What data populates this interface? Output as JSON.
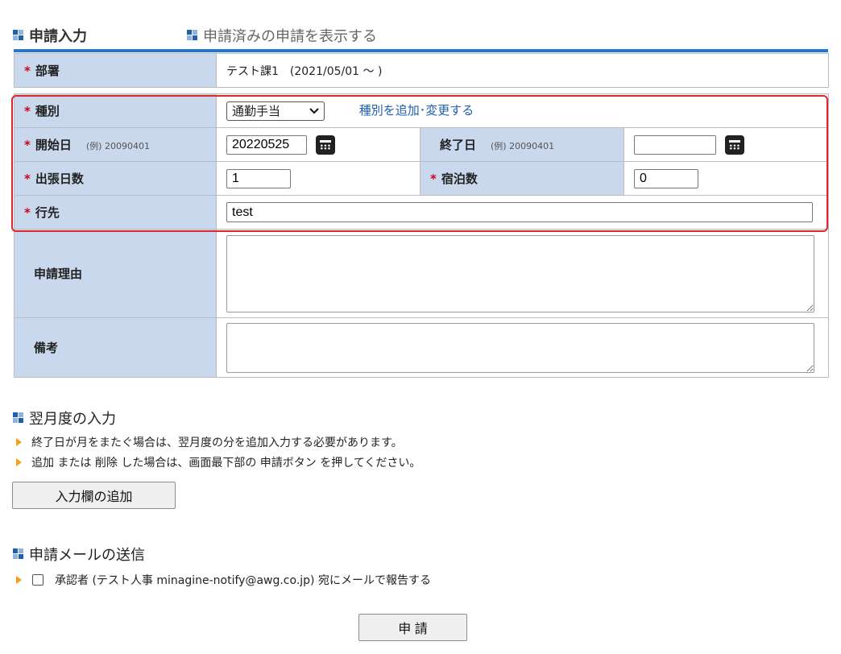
{
  "tabs": {
    "active": "申請入力",
    "other": "申請済みの申請を表示する"
  },
  "form": {
    "dept": {
      "label": "部署",
      "value": "テスト課1　(2021/05/01 〜 )"
    },
    "type": {
      "label": "種別",
      "selected": "通勤手当",
      "link": "種別を追加･変更する"
    },
    "start": {
      "label": "開始日",
      "example": "(例) 20090401",
      "value": "20220525"
    },
    "end": {
      "label": "終了日",
      "example": "(例) 20090401",
      "value": ""
    },
    "days": {
      "label": "出張日数",
      "value": "1"
    },
    "nights": {
      "label": "宿泊数",
      "value": "0"
    },
    "dest": {
      "label": "行先",
      "value": "test"
    },
    "reason": {
      "label": "申請理由",
      "value": ""
    },
    "remarks": {
      "label": "備考",
      "value": ""
    },
    "required_mark": "*"
  },
  "next_month": {
    "heading": "翌月度の入力",
    "notes": [
      "終了日が月をまたぐ場合は、翌月度の分を追加入力する必要があります。",
      "追加 または 削除 した場合は、画面最下部の 申請ボタン を押してください。"
    ],
    "add_button": "入力欄の追加"
  },
  "mail": {
    "heading": "申請メールの送信",
    "checkbox_label": "承認者 (テスト人事 minagine-notify@awg.co.jp) 宛にメールで報告する",
    "checked": false
  },
  "submit_button": "申 請",
  "colors": {
    "accent": "#2277d6",
    "label_bg": "#c9d8ec",
    "required": "#d0021b",
    "highlight": "#e2262b"
  }
}
